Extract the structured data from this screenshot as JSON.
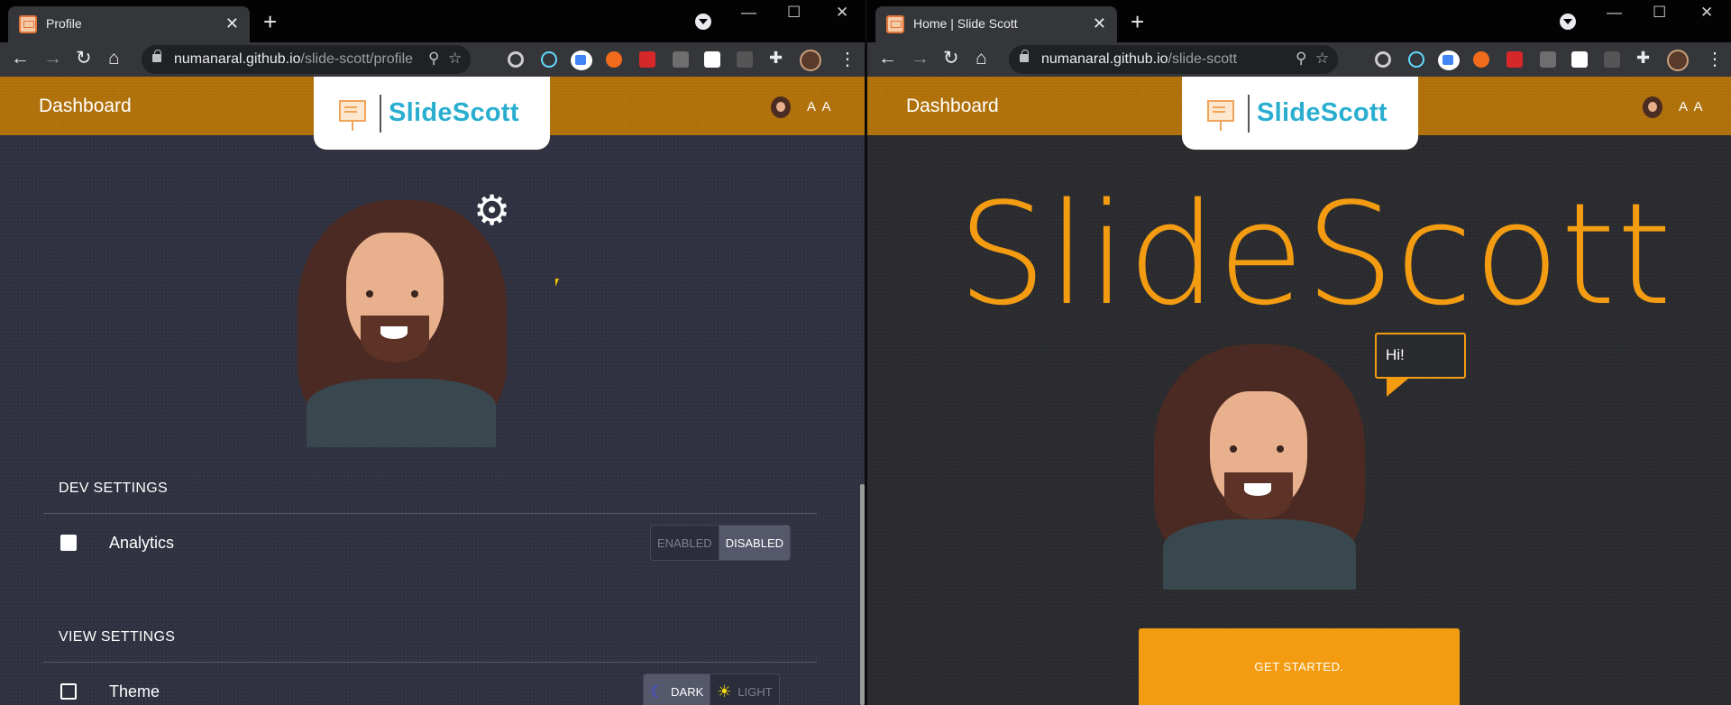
{
  "left_window": {
    "tab_title": "Profile",
    "url_host": "numanaral.github.io",
    "url_path": "/slide-scott/profile",
    "app_title": "Dashboard",
    "logo_text": "SlideScott",
    "user_initials": "A A",
    "dev_settings": {
      "heading": "DEV SETTINGS",
      "analytics_label": "Analytics",
      "enabled_label": "ENABLED",
      "disabled_label": "DISABLED",
      "selected": "DISABLED"
    },
    "view_settings": {
      "heading": "VIEW SETTINGS",
      "theme_label": "Theme",
      "dark_label": "DARK",
      "light_label": "LIGHT",
      "selected": "DARK"
    }
  },
  "right_window": {
    "tab_title": "Home | Slide Scott",
    "url_host": "numanaral.github.io",
    "url_path": "/slide-scott",
    "app_title": "Dashboard",
    "logo_text": "SlideScott",
    "user_initials": "A A",
    "hero_title": "SlideScott",
    "speech_bubble": "Hi!",
    "cta_label": "GET STARTED."
  },
  "chrome": {
    "close_glyph": "✕",
    "new_tab_glyph": "+",
    "back_glyph": "←",
    "forward_glyph": "→",
    "reload_glyph": "↻",
    "home_glyph": "⌂",
    "zoom_glyph": "⚲",
    "star_glyph": "☆",
    "extensions_glyph": "✚",
    "menu_glyph": "⋮",
    "minimize_glyph": "—",
    "maximize_glyph": "☐",
    "window_close_glyph": "✕",
    "gear_glyph": "⚙"
  },
  "colors": {
    "app_bar": "#b5750c",
    "accent_orange": "#f39c12",
    "logo_teal": "#2aaed0",
    "left_bg": "#2f3140",
    "right_bg": "#2a2b2e"
  }
}
